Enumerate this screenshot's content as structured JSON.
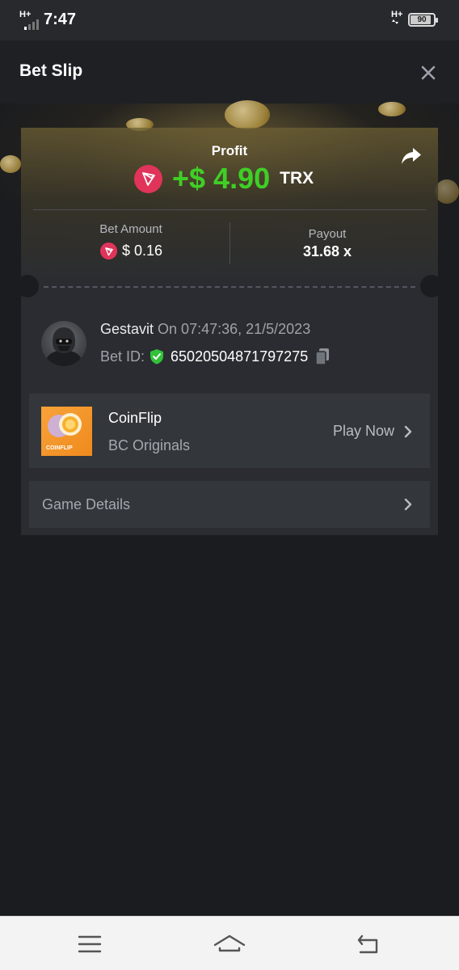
{
  "status_bar": {
    "time": "7:47",
    "network_left": "H+",
    "network_right": "H+",
    "battery": "90"
  },
  "header": {
    "title": "Bet Slip",
    "close_icon": "close-icon"
  },
  "profit": {
    "label": "Profit",
    "amount": "+$ 4.90",
    "currency": "TRX",
    "color": "#3fcf26"
  },
  "bet": {
    "amount_label": "Bet Amount",
    "amount_value": "$ 0.16",
    "payout_label": "Payout",
    "payout_value": "31.68 x"
  },
  "user": {
    "name": "Gestavit",
    "timestamp": "On 07:47:36, 21/5/2023",
    "bet_id_label": "Bet ID:",
    "bet_id_value": "65020504871797275"
  },
  "game": {
    "name": "CoinFlip",
    "provider": "BC Originals",
    "thumb_label": "COINFLIP",
    "play_label": "Play Now"
  },
  "details": {
    "label": "Game Details"
  },
  "icons": {
    "coin": "trx-coin-icon",
    "share": "share-icon",
    "verified": "shield-check-icon",
    "copy": "copy-icon",
    "chevron": "chevron-right-icon"
  },
  "colors": {
    "accent_green": "#3fcf26",
    "trx_red": "#e0345a",
    "verified_green": "#31c23a"
  },
  "nav_bar": {
    "menu": "menu-icon",
    "home": "home-icon",
    "back": "back-icon"
  }
}
